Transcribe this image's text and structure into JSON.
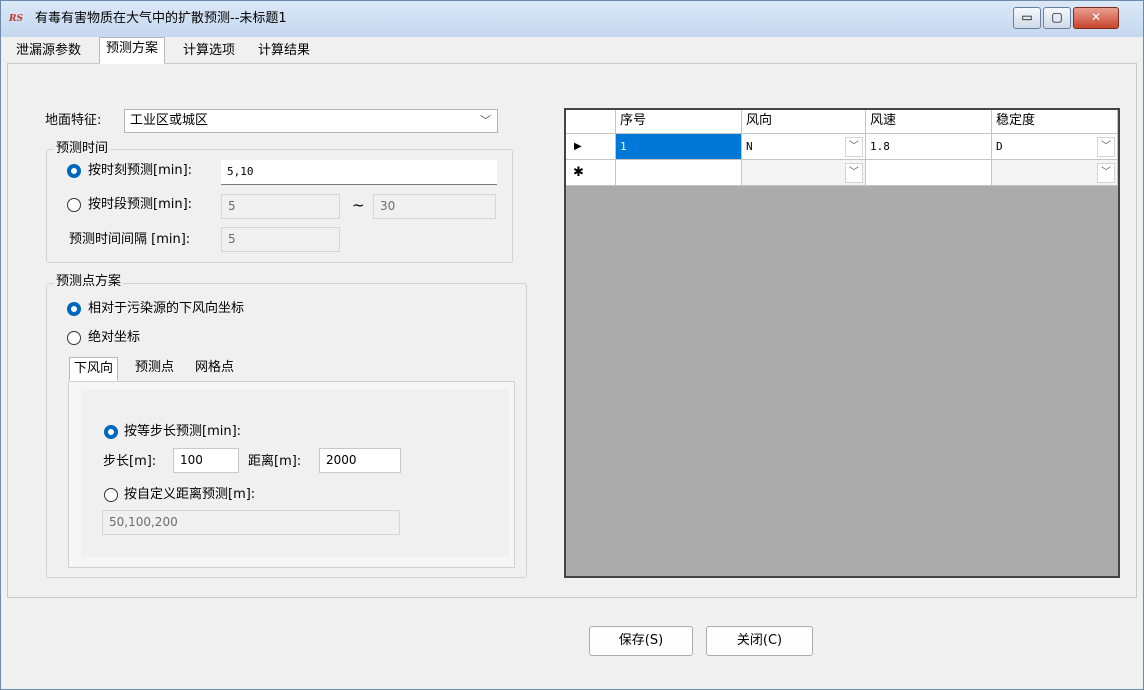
{
  "window": {
    "icon_text": "RS",
    "title": "有毒有害物质在大气中的扩散预测--未标题1",
    "controls": {
      "minimize": "▭",
      "maximize": "▢",
      "close": "✕"
    }
  },
  "tabs": [
    {
      "label": "泄漏源参数"
    },
    {
      "label": "预测方案",
      "active": true
    },
    {
      "label": "计算选项"
    },
    {
      "label": "计算结果"
    }
  ],
  "surface": {
    "label": "地面特征:",
    "value": "工业区或城区"
  },
  "time_group": {
    "title": "预测时间",
    "by_moment_label": "按时刻预测[min]:",
    "by_moment_value": "5,10",
    "by_period_label": "按时段预测[min]:",
    "period_from": "5",
    "tilde": "~",
    "period_to": "30",
    "interval_label": "预测时间间隔 [min]:",
    "interval_value": "5"
  },
  "points_group": {
    "title": "预测点方案",
    "relative_label": "相对于污染源的下风向坐标",
    "absolute_label": "绝对坐标",
    "subtabs": [
      {
        "label": "下风向",
        "active": true
      },
      {
        "label": "预测点"
      },
      {
        "label": "网格点"
      }
    ],
    "equal_step_label": "按等步长预测[min]:",
    "step_label": "步长[m]:",
    "step_value": "100",
    "distance_label": "距离[m]:",
    "distance_value": "2000",
    "custom_label": "按自定义距离预测[m]:",
    "custom_value": "50,100,200"
  },
  "grid": {
    "columns": [
      "序号",
      "风向",
      "风速",
      "稳定度"
    ],
    "rows": [
      {
        "indicator": "▶",
        "values": [
          "1",
          "N",
          "1.8",
          "D"
        ]
      },
      {
        "indicator": "✱",
        "values": [
          "",
          "",
          "",
          ""
        ]
      }
    ]
  },
  "buttons": {
    "save": "保存(S)",
    "close": "关闭(C)"
  },
  "colors": {
    "selection": "#0078d7",
    "radio_accent": "#0067c0",
    "grid_background": "#ababab"
  }
}
